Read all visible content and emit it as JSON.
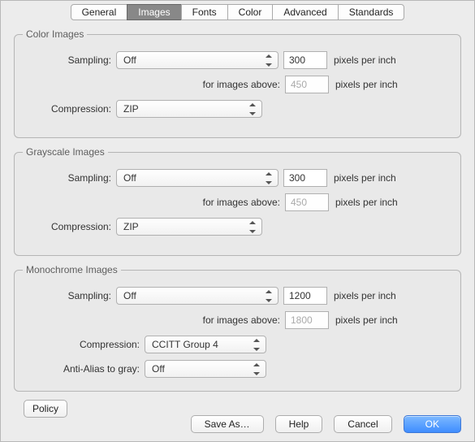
{
  "tabs": {
    "general": "General",
    "images": "Images",
    "fonts": "Fonts",
    "color": "Color",
    "advanced": "Advanced",
    "standards": "Standards"
  },
  "labels": {
    "sampling": "Sampling:",
    "compression": "Compression:",
    "forImagesAbove": "for images above:",
    "ppi": "pixels per inch",
    "antiAlias": "Anti-Alias to gray:"
  },
  "colorImages": {
    "legend": "Color Images",
    "sampling": "Off",
    "dpi": "300",
    "aboveDpi": "450",
    "compression": "ZIP"
  },
  "grayscaleImages": {
    "legend": "Grayscale Images",
    "sampling": "Off",
    "dpi": "300",
    "aboveDpi": "450",
    "compression": "ZIP"
  },
  "monochromeImages": {
    "legend": "Monochrome Images",
    "sampling": "Off",
    "dpi": "1200",
    "aboveDpi": "1800",
    "compression": "CCITT Group 4",
    "antiAlias": "Off"
  },
  "buttons": {
    "policy": "Policy",
    "saveAs": "Save As…",
    "help": "Help",
    "cancel": "Cancel",
    "ok": "OK"
  }
}
